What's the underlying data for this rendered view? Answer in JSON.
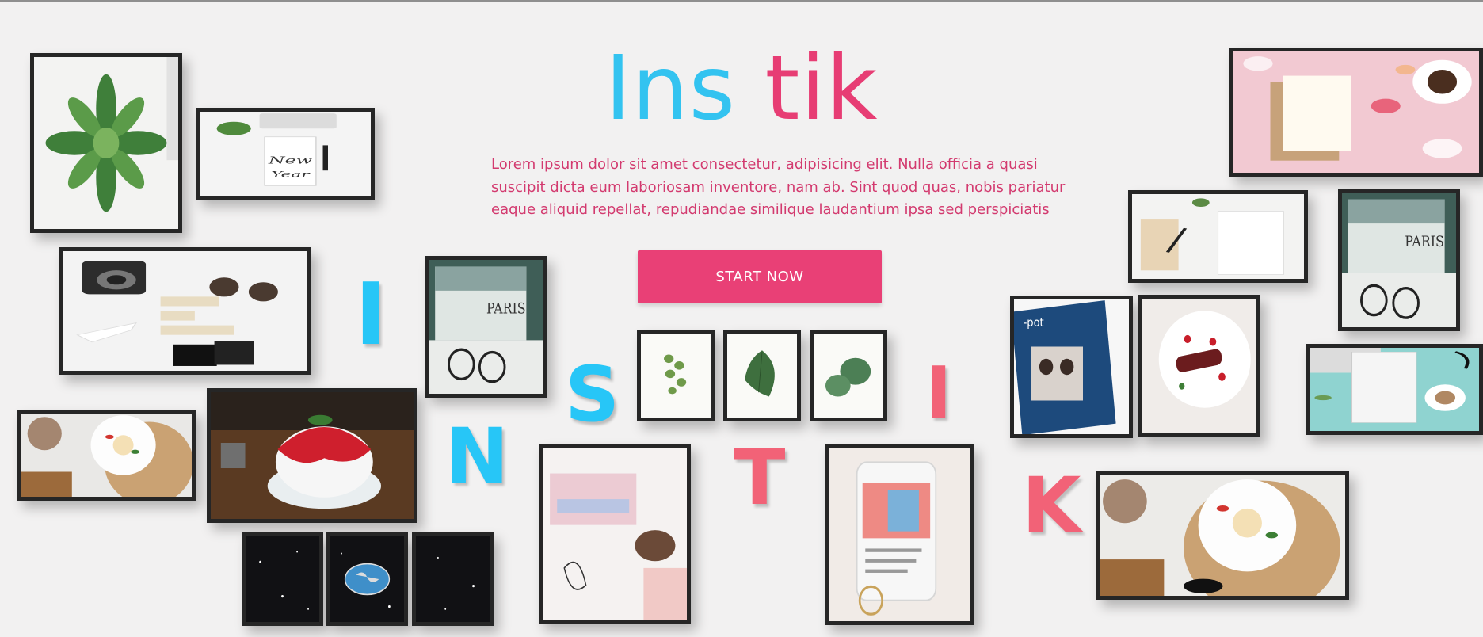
{
  "hero": {
    "title_part1": "Ins",
    "title_part2": "tik",
    "description_lines": [
      "Lorem ipsum dolor sit amet consectetur, adipisicing elit. Nulla officia a quasi",
      "suscipit dicta eum laboriosam inventore, nam ab. Sint quod quas, nobis pariatur",
      "eaque aliquid repellat, repudiandae similique laudantium ipsa sed perspiciatis"
    ],
    "cta_label": "START NOW"
  },
  "decor_letters": [
    {
      "text": "I",
      "color": "blue"
    },
    {
      "text": "N",
      "color": "blue"
    },
    {
      "text": "S",
      "color": "blue"
    },
    {
      "text": "T",
      "color": "pink"
    },
    {
      "text": "I",
      "color": "pink"
    },
    {
      "text": "K",
      "color": "pink"
    }
  ],
  "photos": [
    "succulent-photo",
    "new-year-desk-photo",
    "camera-travel-photo",
    "paris-book-photo",
    "dessert-plate-photo",
    "shaved-ice-photo",
    "space-triptych-left",
    "space-globe-photo",
    "space-triptych-right",
    "leaf-print-1",
    "leaf-print-2",
    "leaf-print-3",
    "pastel-stationery-photo",
    "phone-instagram-photo",
    "pink-notebook-photo",
    "desk-notepad-photo",
    "paris-book-photo-2",
    "magazine-photo",
    "cake-plate-photo",
    "laptop-notepad-photo",
    "dessert-plate-photo-2"
  ],
  "colors": {
    "accent_blue": "#33c3f0",
    "accent_pink": "#e73d74",
    "button": "#e94076",
    "background": "#f2f1f1",
    "frame": "#262626"
  }
}
